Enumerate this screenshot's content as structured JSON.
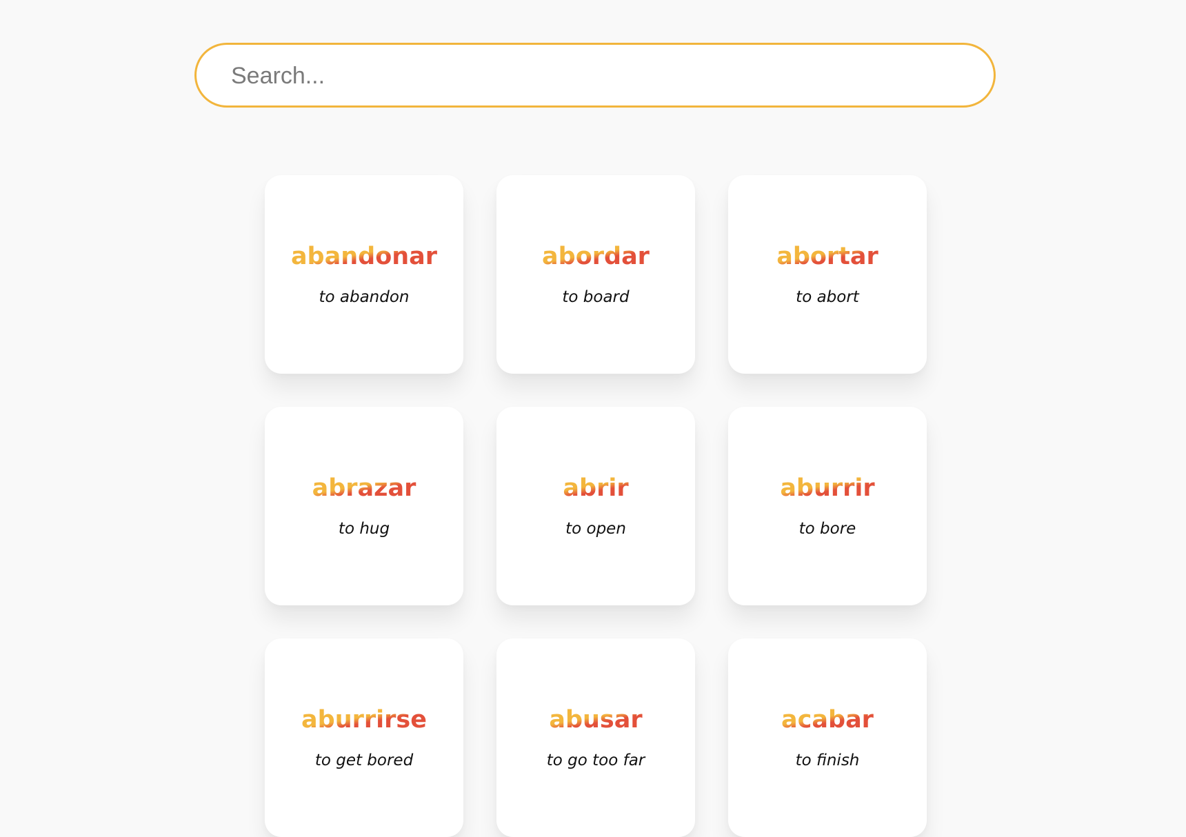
{
  "search": {
    "placeholder": "Search...",
    "value": ""
  },
  "colors": {
    "accent_yellow": "#f3b63d",
    "accent_red": "#e3503a",
    "background": "#f9f9f9",
    "card": "#ffffff"
  },
  "cards": [
    {
      "word": "abandonar",
      "translation": "to abandon"
    },
    {
      "word": "abordar",
      "translation": "to board"
    },
    {
      "word": "abortar",
      "translation": "to abort"
    },
    {
      "word": "abrazar",
      "translation": "to hug"
    },
    {
      "word": "abrir",
      "translation": "to open"
    },
    {
      "word": "aburrir",
      "translation": "to bore"
    },
    {
      "word": "aburrirse",
      "translation": "to get bored"
    },
    {
      "word": "abusar",
      "translation": "to go too far"
    },
    {
      "word": "acabar",
      "translation": "to finish"
    }
  ]
}
